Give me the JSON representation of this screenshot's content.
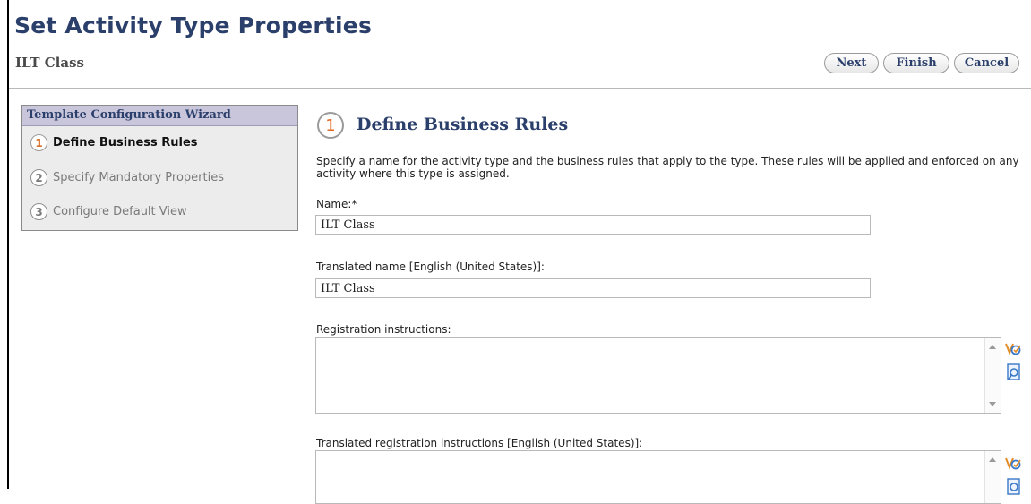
{
  "header": {
    "title": "Set Activity Type Properties",
    "subtitle": "ILT Class",
    "buttons": {
      "next": "Next",
      "finish": "Finish",
      "cancel": "Cancel"
    }
  },
  "wizard": {
    "title": "Template Configuration Wizard",
    "steps": [
      {
        "num": "1",
        "label": "Define Business Rules",
        "active": true
      },
      {
        "num": "2",
        "label": "Specify Mandatory Properties",
        "active": false
      },
      {
        "num": "3",
        "label": "Configure Default View",
        "active": false
      }
    ]
  },
  "section": {
    "num": "1",
    "title": "Define Business Rules",
    "description": "Specify a name for the activity type and the business rules that apply to the type. These rules will be applied and enforced on any activity where this type is assigned."
  },
  "form": {
    "name_label": "Name:*",
    "name_value": "ILT Class",
    "translated_name_label": "Translated name [English (United States)]:",
    "translated_name_value": "ILT Class",
    "registration_label": "Registration instructions:",
    "translated_registration_label": "Translated registration instructions [English (United States)]:"
  },
  "icons": {
    "spellcheck": "spellcheck-icon",
    "preview": "preview-icon"
  }
}
